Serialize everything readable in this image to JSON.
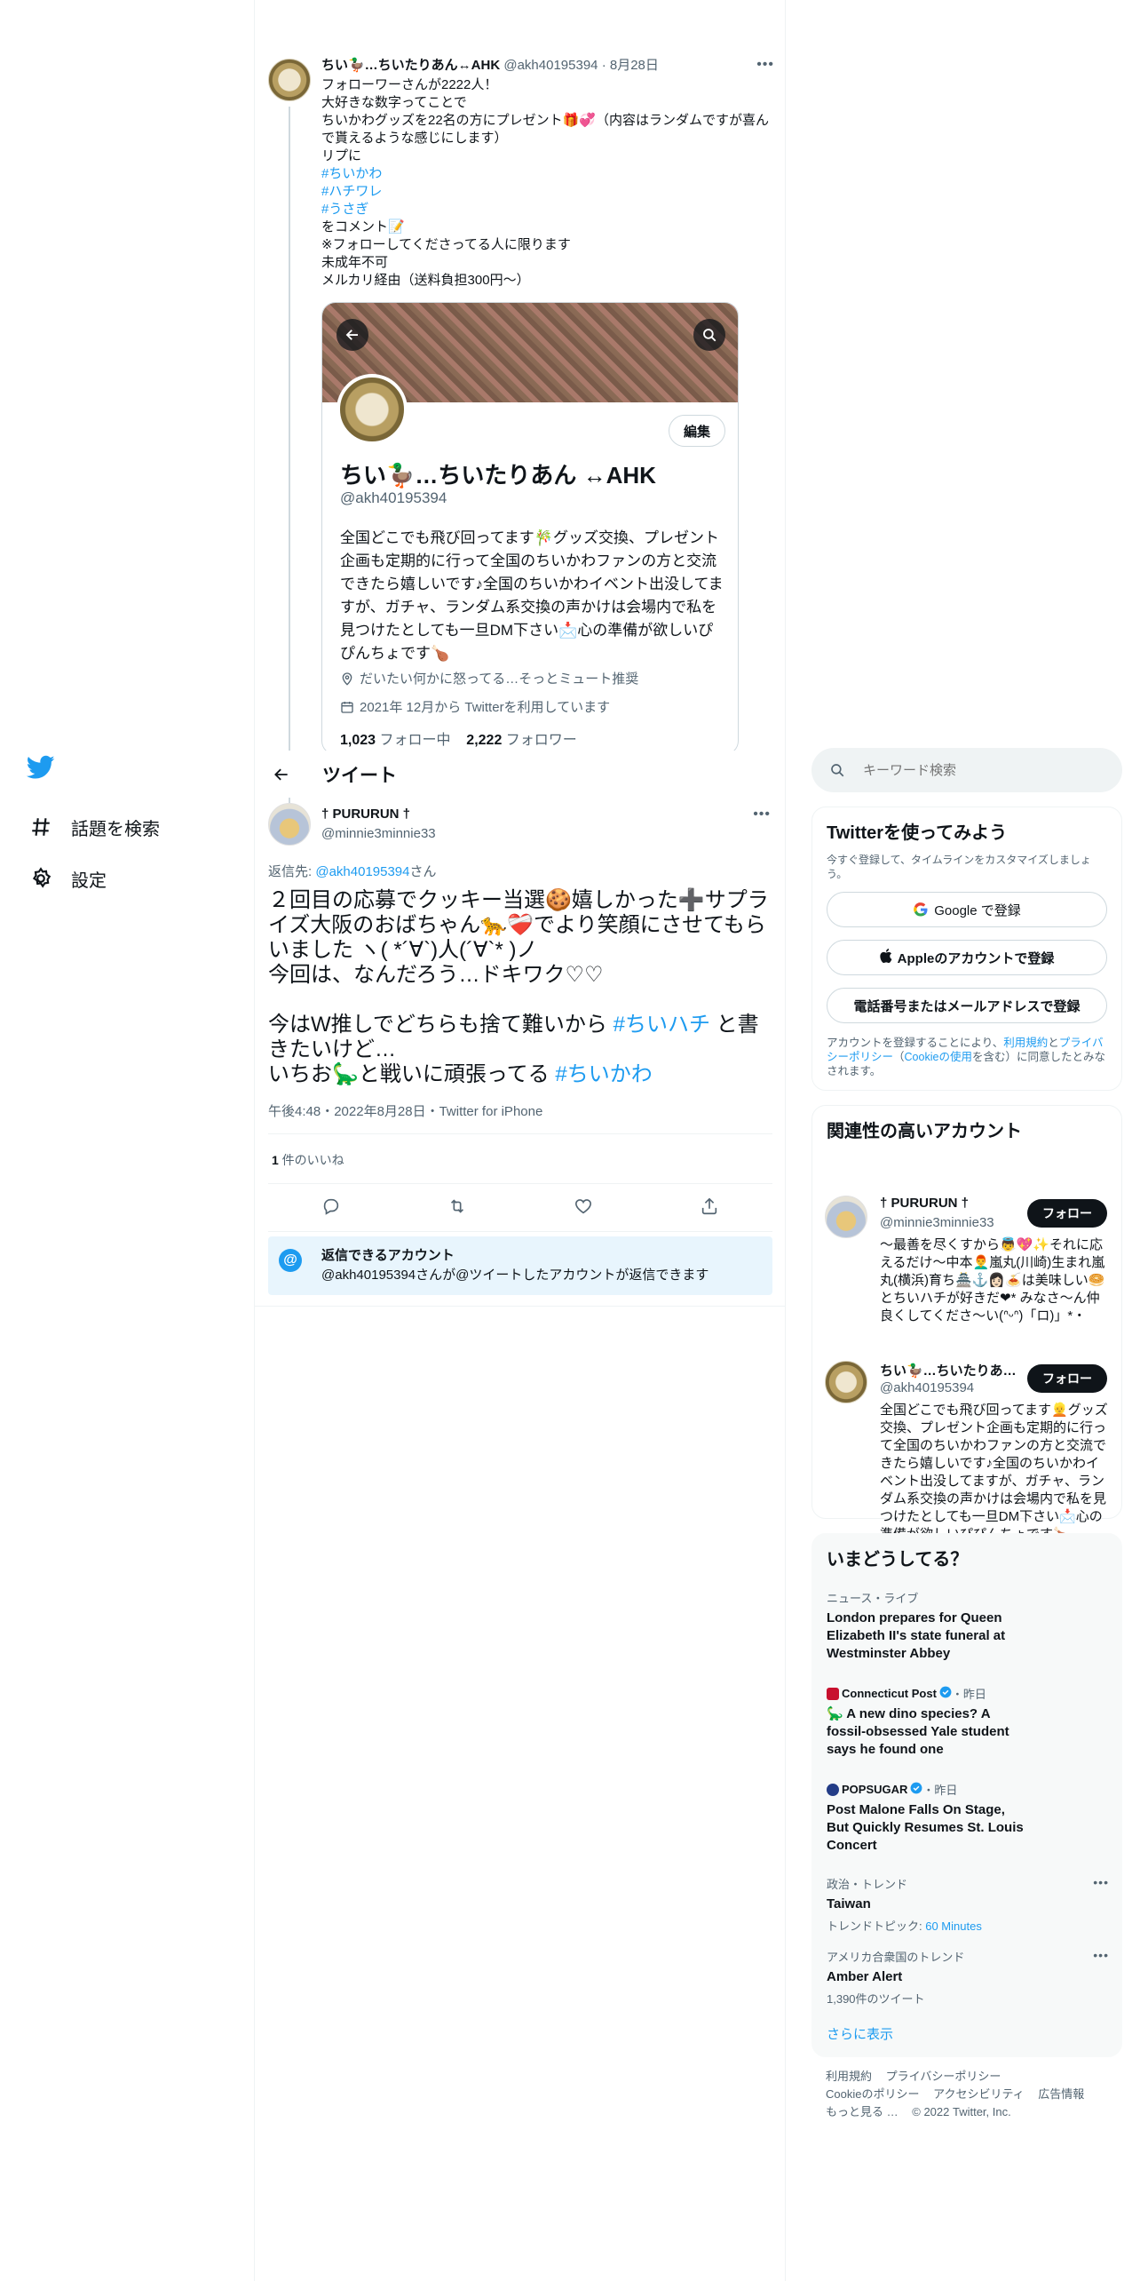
{
  "parent_tweet": {
    "name": "ちい🦆…ちいたりあん↔AHK",
    "handle": "@akh40195394",
    "date": "8月28日",
    "lines": [
      "フォローワーさんが2222人！",
      "大好きな数字ってことで",
      "ちいかわグッズを22名の方にプレゼント🎁💞（内容はランダムですが喜んで貰えるような感じにします）",
      "リプに",
      "#ちいかわ",
      "#ハチワレ",
      "#うさぎ",
      "をコメント📝",
      "※フォローしてくださってる人に限ります",
      "未成年不可",
      "メルカリ経由（送料負担300円〜）"
    ]
  },
  "profile_card": {
    "edit_label": "編集",
    "name": "ちい🦆…ちいたりあん ↔AHK",
    "handle": "@akh40195394",
    "bio": "全国どこでも飛び回ってます🎋グッズ交換、プレゼント企画も定期的に行って全国のちいかわファンの方と交流できたら嬉しいです♪全国のちいかわイベント出没してますが、ガチャ、ランダム系交換の声かけは会場内で私を見つけたとしても一旦DM下さい📩心の準備が欲しいぴぴんちょです🍗",
    "location": "だいたい何かに怒ってる…そっとミュート推奨",
    "joined": "2021年 12月から Twitterを利用しています",
    "following_count": "1,023",
    "following_label": "フォロー中",
    "followers_count": "2,222",
    "followers_label": "フォロワー"
  },
  "nav": {
    "explore": "話題を検索",
    "settings": "設定"
  },
  "header": {
    "title": "ツイート"
  },
  "main_tweet": {
    "name": "† PURURUN †",
    "handle": "@minnie3minnie33",
    "reply_prefix": "返信先: ",
    "reply_to": "@akh40195394",
    "reply_suffix": "さん",
    "body_line1": "２回目の応募でクッキー当選🍪嬉しかった➕サプライズ大阪のおばちゃん🐆❤️‍🩹でより笑顔にさせてもらいました ヽ( *´∀`)人(´∀`* )ノ",
    "body_line2": "今回は、なんだろう…ドキワク♡♡",
    "body_line3a": "今はW推しでどちらも捨て難いから ",
    "hashtag1": "#ちいハチ",
    "body_line3b": " と書きたいけど…",
    "body_line4a": "いちお🦕と戦いに頑張ってる ",
    "hashtag2": "#ちいかわ",
    "timestamp": "午後4:48・2022年8月28日・Twitter for iPhone",
    "likes_count": "1",
    "likes_label": " 件のいいね",
    "who_can_reply_title": "返信できるアカウント",
    "who_can_reply_text": "@akh40195394さんが@ツイートしたアカウントが返信できます"
  },
  "search": {
    "placeholder": "キーワード検索"
  },
  "signup": {
    "title": "Twitterを使ってみよう",
    "subtitle": "今すぐ登録して、タイムラインをカスタマイズしましょう。",
    "google": "Google で登録",
    "apple": "Appleのアカウントで登録",
    "phone": "電話番号またはメールアドレスで登録",
    "terms_a": "アカウントを登録することにより、",
    "terms_link1": "利用規約",
    "terms_b": "と",
    "terms_link2": "プライバシーポリシー",
    "terms_c": "（",
    "terms_link3": "Cookieの使用",
    "terms_d": "を含む）に同意したとみなされます。"
  },
  "related": {
    "title": "関連性の高いアカウント",
    "follow_label": "フォロー",
    "accounts": [
      {
        "name": "† PURURUN †",
        "handle": "@minnie3minnie33",
        "bio": "〜最善を尽くすから👼💖✨それに応えるだけ〜中本👨‍🦰嵐丸(川崎)生まれ嵐丸(横浜)育ち🏯⚓️👩🏻🍝は美味しい🥯とちいハチが好きだ❤︎* みなさ〜ん仲良くしてくださ〜い(ᐢᵕᐢ)「ロ)」*・"
      },
      {
        "name": "ちい🦆…ちいたりあ…",
        "handle": "@akh40195394",
        "bio": "全国どこでも飛び回ってます👱グッズ交換、プレゼント企画も定期的に行って全国のちいかわファンの方と交流できたら嬉しいです♪全国のちいかわイベント出没してますが、ガチャ、ランダム系交換の声かけは会場内で私を見つけたとしても一旦DM下さい📩心の準備が欲しいぴぴんちょです🍗"
      }
    ]
  },
  "trends": {
    "title": "いまどうしてる？",
    "items": [
      {
        "category": "ニュース・ライブ",
        "title": "London prepares for Queen Elizabeth II's state funeral at Westminster Abbey"
      },
      {
        "source": "Connecticut Post",
        "time": "・昨日",
        "title": "🦕 A new dino species? A fossil-obsessed Yale student says he found one"
      },
      {
        "source": "POPSUGAR",
        "time": "・昨日",
        "title": "Post Malone Falls On Stage, But Quickly Resumes St. Louis Concert"
      },
      {
        "category": "政治・トレンド",
        "title": "Taiwan",
        "sub_prefix": "トレンドトピック: ",
        "sub_link": "60 Minutes"
      },
      {
        "category": "アメリカ合衆国のトレンド",
        "title": "Amber Alert",
        "sub": "1,390件のツイート"
      }
    ],
    "show_more": "さらに表示"
  },
  "footer": {
    "links1": [
      "利用規約",
      "プライバシーポリシー"
    ],
    "links2": [
      "Cookieのポリシー",
      "アクセシビリティ",
      "広告情報"
    ],
    "more": "もっと見る …",
    "copyright": "© 2022 Twitter, Inc."
  },
  "colors": {
    "accent": "#1d9bf0",
    "text": "#0f1419",
    "muted": "#536471",
    "border": "#eff3f4"
  }
}
